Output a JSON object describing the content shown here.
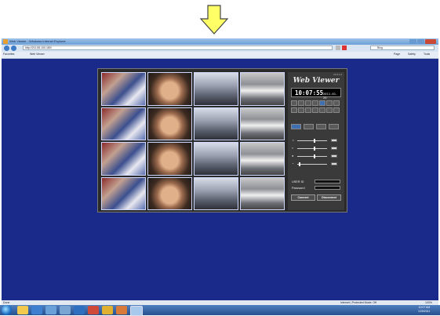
{
  "window": {
    "title": "Web Viewer - Windows Internet Explorer"
  },
  "browser": {
    "address": "http://211.55.100.180/",
    "search_engine": "Bing",
    "favorites_label": "Favorites",
    "tab_label": "Web Viewer",
    "cmd_page": "Page",
    "cmd_safety": "Safety",
    "cmd_tools": "Tools"
  },
  "status": {
    "left": "Done",
    "zone": "Internet | Protected Mode: Off",
    "zoom": "100%"
  },
  "viewer": {
    "version": "V2.0.1.0",
    "brand": "Web Viewer",
    "time": "10:07:55",
    "date": "2011-01-25",
    "userid_label": "USER ID",
    "password_label": "Password",
    "connect_label": "Connect",
    "disconnect_label": "Disconnect"
  },
  "tray": {
    "time": "10:07 AM",
    "date": "1/25/2011"
  }
}
